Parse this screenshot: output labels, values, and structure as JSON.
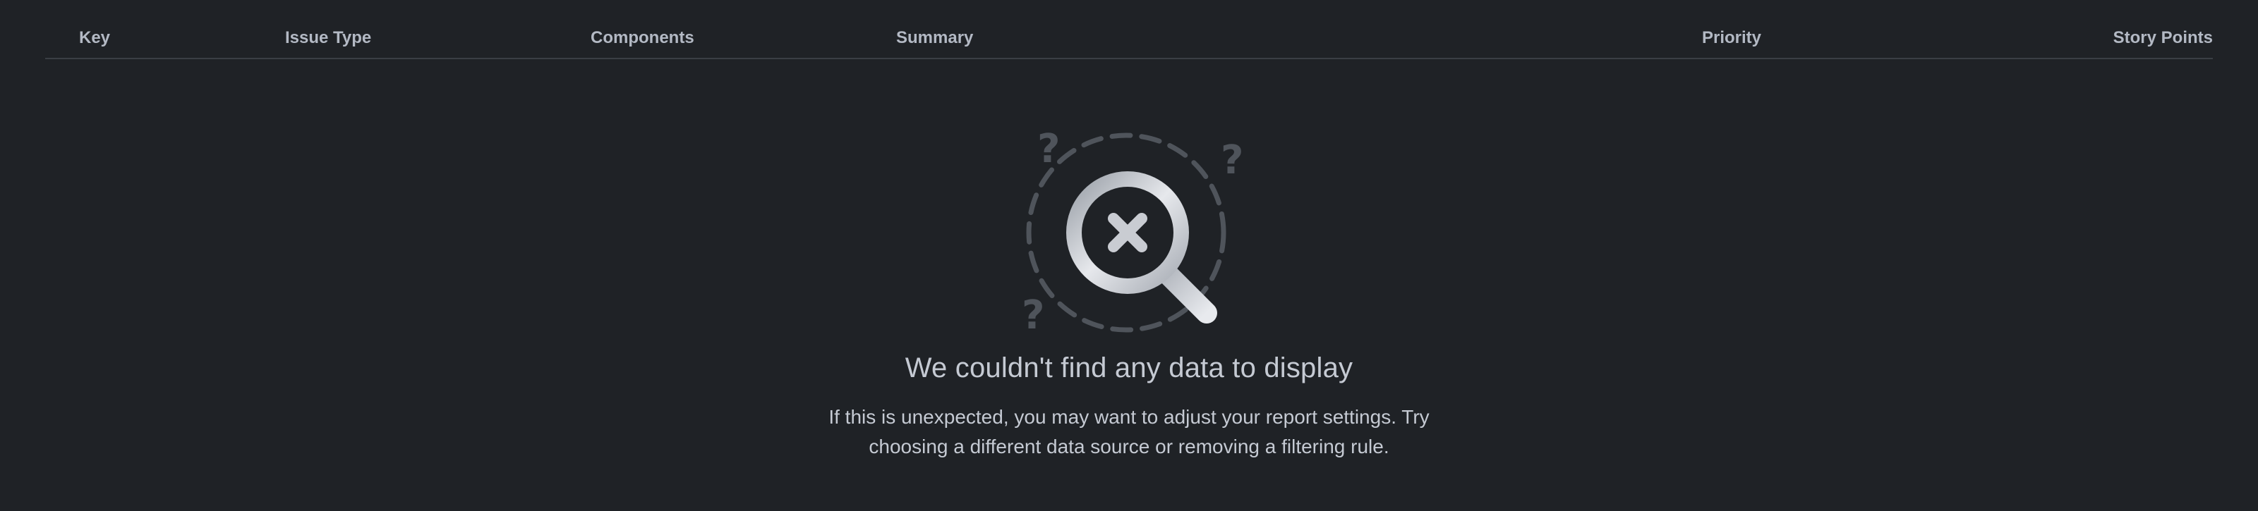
{
  "table": {
    "columns": [
      {
        "label": "Key"
      },
      {
        "label": "Issue Type"
      },
      {
        "label": "Components"
      },
      {
        "label": "Summary"
      },
      {
        "label": "Priority"
      },
      {
        "label": "Story Points"
      }
    ]
  },
  "empty_state": {
    "title": "We couldn't find any data to display",
    "description": "If this is unexpected, you may want to adjust your report settings. Try choosing a different data source or removing a filtering rule.",
    "icon": "search-no-results-icon"
  },
  "colors": {
    "background": "#1f2226",
    "header_text": "#b3b9c4",
    "body_text": "#c5cad3",
    "divider": "#3a3e44",
    "illustration_muted": "#4f545b"
  }
}
